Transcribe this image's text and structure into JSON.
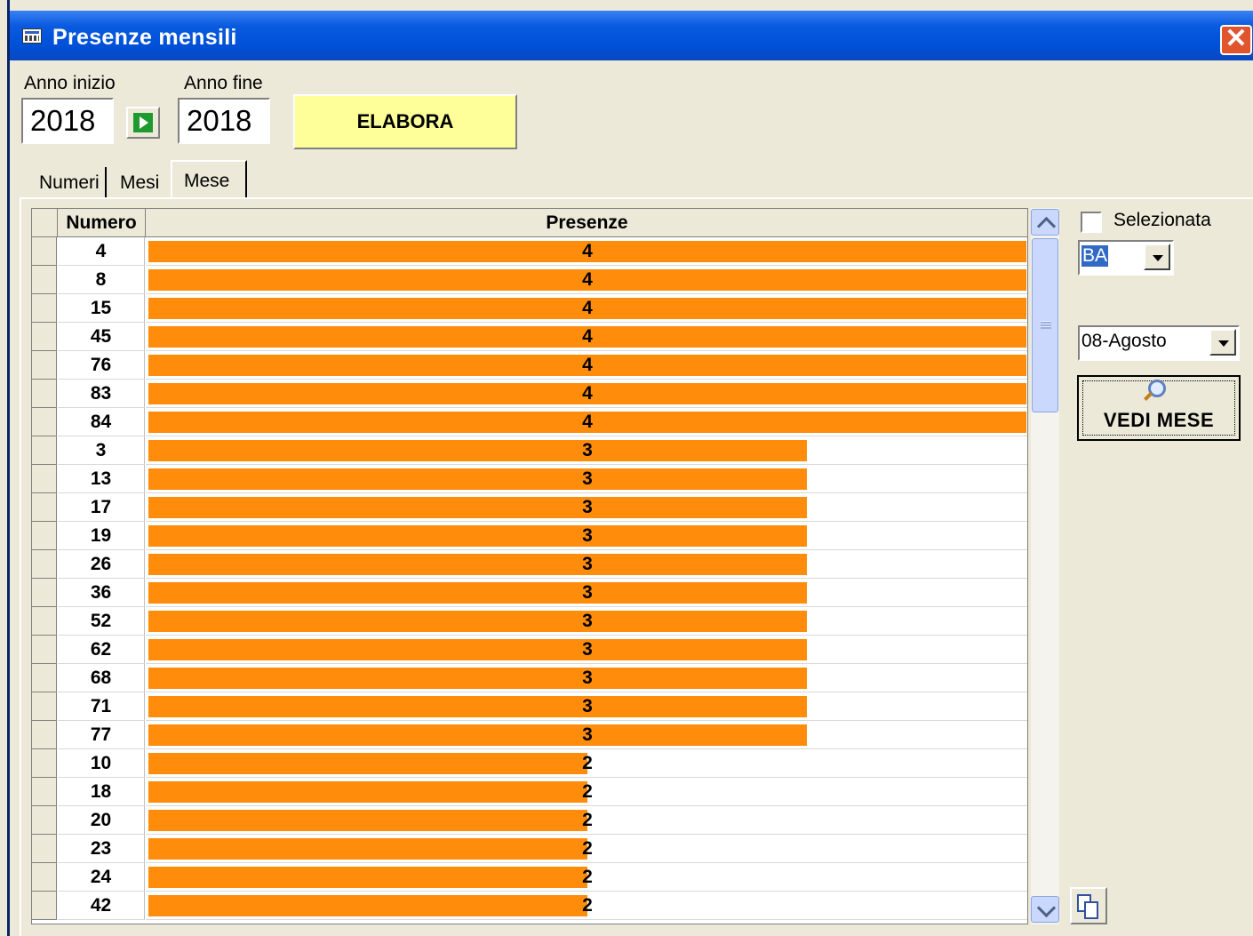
{
  "window": {
    "title": "Presenze mensili",
    "close": "✕"
  },
  "controls": {
    "anno_inizio_label": "Anno inizio",
    "anno_inizio_value": "2018",
    "anno_fine_label": "Anno fine",
    "anno_fine_value": "2018",
    "elabora_label": "ELABORA"
  },
  "tabs": [
    {
      "label": "Numeri"
    },
    {
      "label": "Mesi"
    },
    {
      "label": "Mese"
    }
  ],
  "grid": {
    "columns": [
      "Numero",
      "Presenze"
    ],
    "max_value": 4,
    "rows": [
      {
        "numero": "4",
        "presenze": 4
      },
      {
        "numero": "8",
        "presenze": 4
      },
      {
        "numero": "15",
        "presenze": 4
      },
      {
        "numero": "45",
        "presenze": 4
      },
      {
        "numero": "76",
        "presenze": 4
      },
      {
        "numero": "83",
        "presenze": 4
      },
      {
        "numero": "84",
        "presenze": 4
      },
      {
        "numero": "3",
        "presenze": 3
      },
      {
        "numero": "13",
        "presenze": 3
      },
      {
        "numero": "17",
        "presenze": 3
      },
      {
        "numero": "19",
        "presenze": 3
      },
      {
        "numero": "26",
        "presenze": 3
      },
      {
        "numero": "36",
        "presenze": 3
      },
      {
        "numero": "52",
        "presenze": 3
      },
      {
        "numero": "62",
        "presenze": 3
      },
      {
        "numero": "68",
        "presenze": 3
      },
      {
        "numero": "71",
        "presenze": 3
      },
      {
        "numero": "77",
        "presenze": 3
      },
      {
        "numero": "10",
        "presenze": 2
      },
      {
        "numero": "18",
        "presenze": 2
      },
      {
        "numero": "20",
        "presenze": 2
      },
      {
        "numero": "23",
        "presenze": 2
      },
      {
        "numero": "24",
        "presenze": 2
      },
      {
        "numero": "42",
        "presenze": 2
      }
    ]
  },
  "side": {
    "checkbox_label": "Selezionata",
    "ruota_value": "BA",
    "mese_value": "08-Agosto",
    "vedi_mese_label": "VEDI MESE"
  },
  "colors": {
    "bar": "#FF8C0A",
    "titlebar": "#0050D8",
    "elabora_bg": "#FFFF99"
  }
}
